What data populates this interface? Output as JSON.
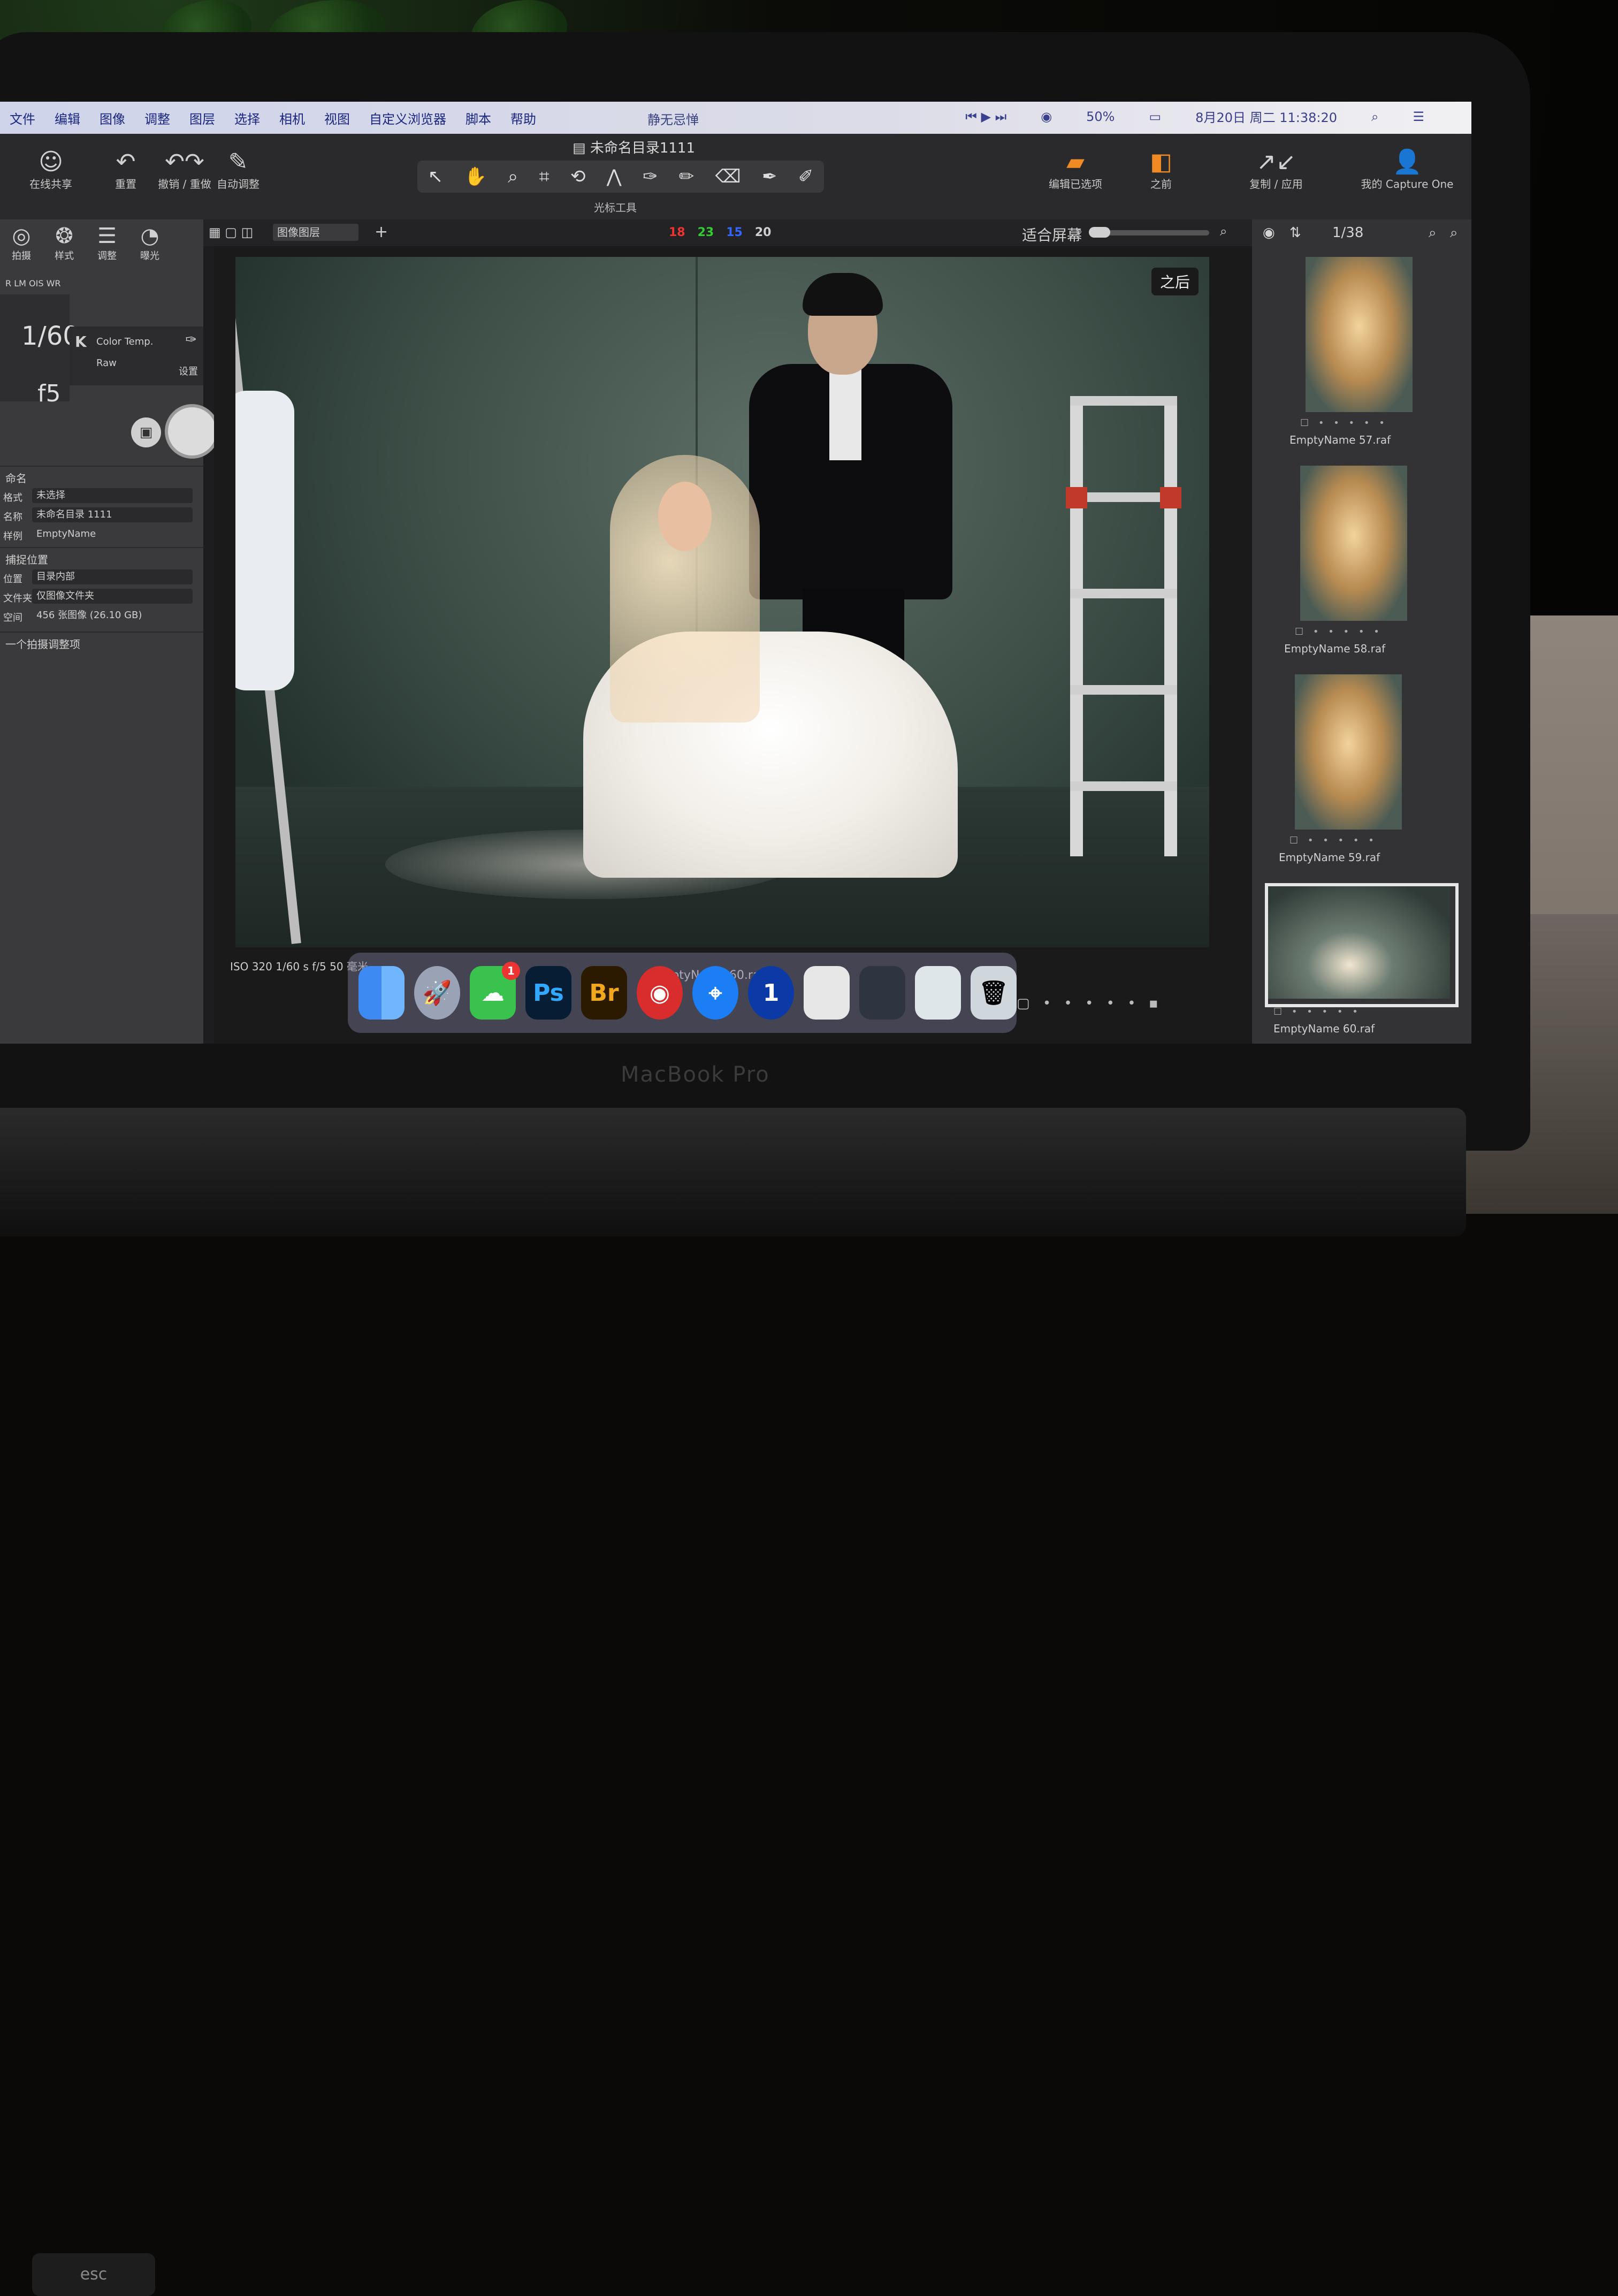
{
  "menubar": {
    "items": [
      "文件",
      "编辑",
      "图像",
      "调整",
      "图层",
      "选择",
      "相机",
      "视图",
      "自定义浏览器",
      "脚本",
      "帮助"
    ],
    "center_title": "静无忌惮",
    "status": {
      "battery": "50%",
      "date_time": "8月20日 周二 11:38:20"
    }
  },
  "toolbar": {
    "document_title": "未命名目录1111",
    "left_buttons": [
      {
        "label": "在线共享",
        "icon": "people-icon"
      },
      {
        "label": "重置",
        "icon": "undo-icon"
      },
      {
        "label": "撤销 / 重做",
        "icon": "undo-redo-icon"
      },
      {
        "label": "自动调整",
        "icon": "magic-wand-icon"
      }
    ],
    "cursor_tools_label": "光标工具",
    "right_buttons": [
      {
        "label": "编辑已选项",
        "icon": "edit-selected-icon"
      },
      {
        "label": "之前",
        "icon": "before-after-icon"
      },
      {
        "label": "复制 / 应用",
        "icon": "copy-apply-icon"
      },
      {
        "label": "我的 Capture One",
        "icon": "user-icon"
      }
    ]
  },
  "left_panel": {
    "tabs": [
      {
        "label": "拍摄",
        "icon": "capture-icon"
      },
      {
        "label": "样式",
        "icon": "styles-icon"
      },
      {
        "label": "调整",
        "icon": "sliders-icon"
      },
      {
        "label": "曝光",
        "icon": "exposure-icon"
      }
    ],
    "lens": "R LM OIS WR",
    "shutter": "1/60",
    "aperture": "f5",
    "color_temp_label": "Color Temp.",
    "raw_label": "Raw",
    "reset_label": "设置",
    "naming_section": "命名",
    "naming_rows": [
      {
        "label": "格式",
        "value": "未选择"
      },
      {
        "label": "名称",
        "value": "未命名目录 1111"
      },
      {
        "label": "样例",
        "value": "EmptyName"
      }
    ],
    "location_section": "捕捉位置",
    "location_rows": [
      {
        "label": "位置",
        "value": "目录内部"
      },
      {
        "label": "文件夹",
        "value": "仅图像文件夹"
      },
      {
        "label": "空间",
        "value": "456 张图像 (26.10 GB)"
      }
    ],
    "next_section": "一个拍摄调整项"
  },
  "viewer": {
    "zoom_label": "适合屏幕",
    "counts": {
      "red": "18",
      "green": "23",
      "blue": "15",
      "total": "20"
    },
    "after_badge": "之后",
    "exif": "ISO 320   1/60 s   f/5   50 毫米",
    "filename": "EmptyName 60.raf",
    "view_mode": "图像图层"
  },
  "browser": {
    "page": "1/38",
    "thumbnails": [
      {
        "name": "EmptyName 57.raf"
      },
      {
        "name": "EmptyName 58.raf"
      },
      {
        "name": "EmptyName 59.raf"
      },
      {
        "name": "EmptyName 60.raf"
      }
    ]
  },
  "dock": {
    "apps": [
      {
        "name": "finder",
        "label": ""
      },
      {
        "name": "launchpad",
        "label": ""
      },
      {
        "name": "wechat",
        "label": "",
        "badge": "1"
      },
      {
        "name": "photoshop",
        "label": "Ps"
      },
      {
        "name": "bridge",
        "label": "Br"
      },
      {
        "name": "netease-music",
        "label": ""
      },
      {
        "name": "safari",
        "label": ""
      },
      {
        "name": "onepassword",
        "label": "1"
      }
    ]
  },
  "hardware": {
    "brand": "MacBook Pro",
    "esc": "esc"
  },
  "colors": {
    "accent_orange": "#f08a24",
    "panel": "#3a3a3c",
    "menubar": "#dcdce8"
  }
}
